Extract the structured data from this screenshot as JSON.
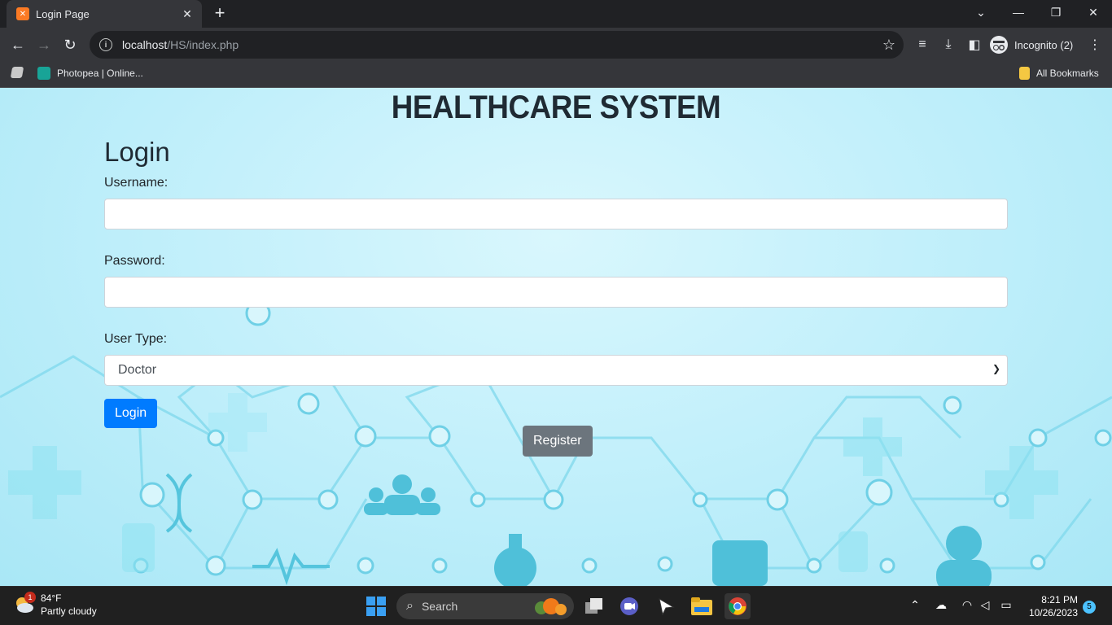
{
  "browser": {
    "tab_title": "Login Page",
    "url_host": "localhost",
    "url_path": "/HS/index.php",
    "profile_label": "Incognito (2)",
    "bookmarks": [
      {
        "label": "Photopea | Online..."
      }
    ],
    "all_bookmarks_label": "All Bookmarks"
  },
  "page": {
    "title": "HEALTHCARE SYSTEM",
    "form_heading": "Login",
    "username_label": "Username:",
    "password_label": "Password:",
    "user_type_label": "User Type:",
    "user_type_selected": "Doctor",
    "login_button": "Login",
    "register_button": "Register"
  },
  "taskbar": {
    "weather_temp": "84°F",
    "weather_desc": "Partly cloudy",
    "weather_badge": "1",
    "search_placeholder": "Search",
    "time": "8:21 PM",
    "date": "10/26/2023",
    "notification_count": "5"
  },
  "colors": {
    "primary_button": "#007bff",
    "secondary_button": "#6c757d",
    "page_background": "#c3f0fb"
  }
}
